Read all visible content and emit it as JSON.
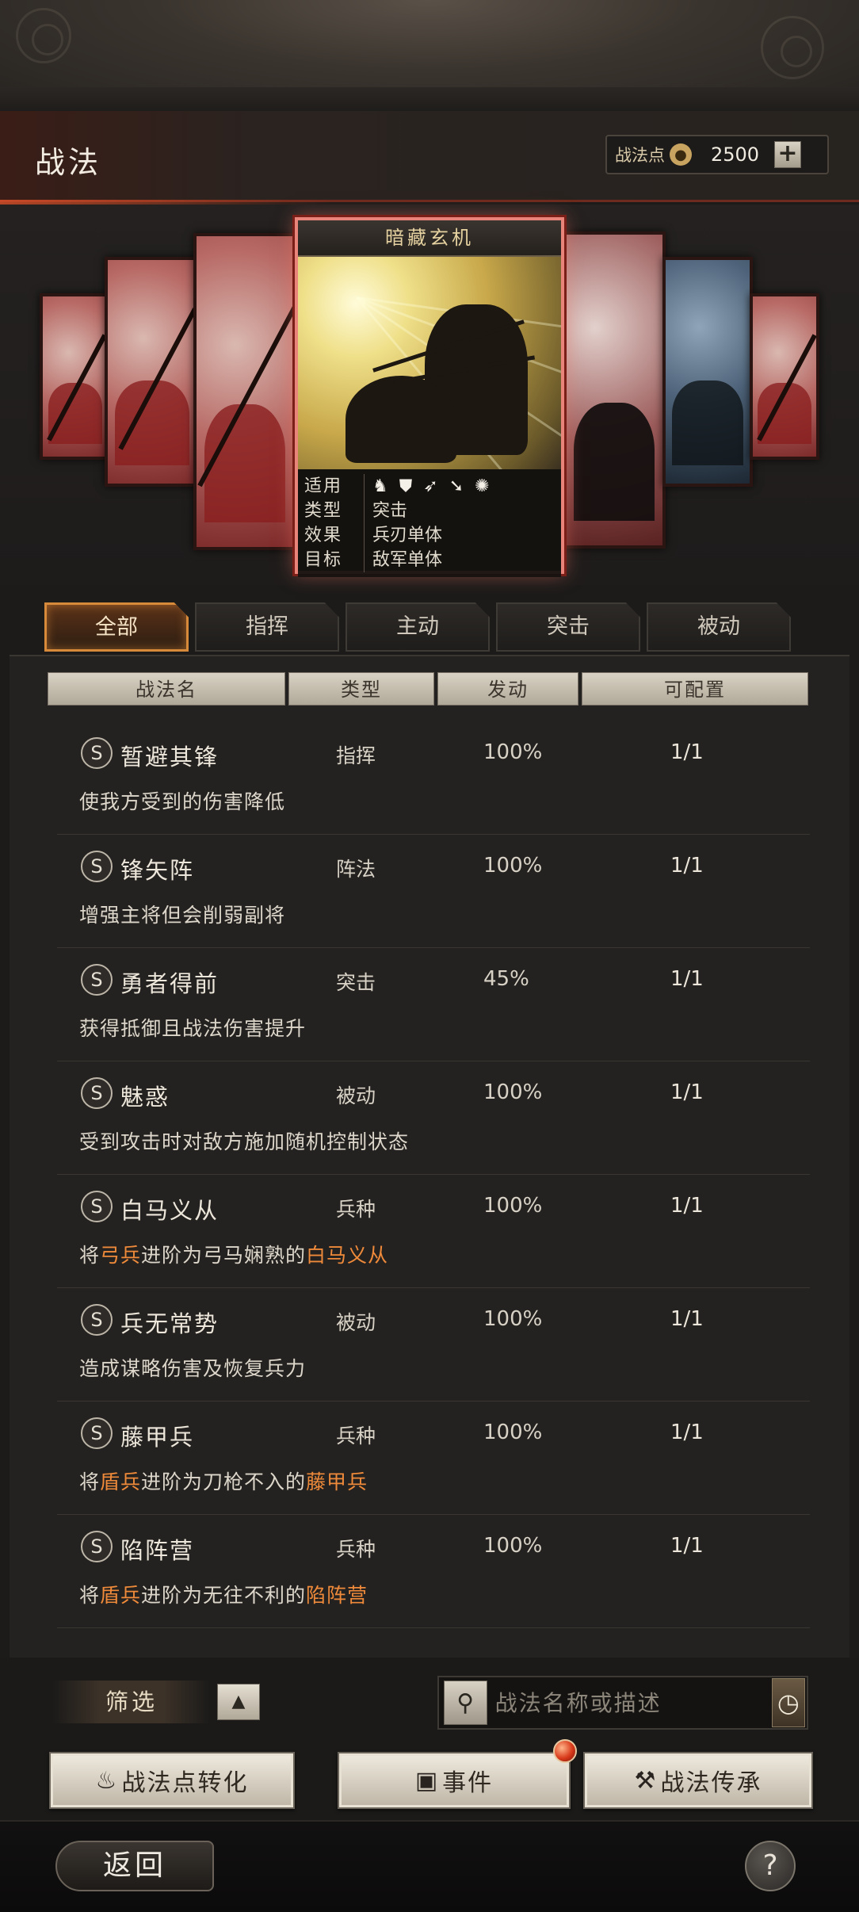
{
  "header": {
    "title": "战法",
    "points_label": "战法点",
    "points_value": "2500",
    "plus_label": "+"
  },
  "featured_card": {
    "title": "暗藏玄机",
    "info": [
      {
        "key": "适用",
        "value": ""
      },
      {
        "key": "类型",
        "value": "突击"
      },
      {
        "key": "效果",
        "value": "兵刃单体"
      },
      {
        "key": "目标",
        "value": "敌军单体"
      }
    ],
    "unit_icons": [
      "cavalry-icon",
      "shield-icon",
      "bow-icon",
      "spear-icon",
      "chariot-icon"
    ]
  },
  "tabs": [
    {
      "label": "全部",
      "active": true
    },
    {
      "label": "指挥",
      "active": false
    },
    {
      "label": "主动",
      "active": false
    },
    {
      "label": "突击",
      "active": false
    },
    {
      "label": "被动",
      "active": false
    }
  ],
  "columns": {
    "name": "战法名",
    "type": "类型",
    "rate": "发动",
    "config": "可配置"
  },
  "skills": [
    {
      "grade": "S",
      "name": "暂避其锋",
      "type": "指挥",
      "rate": "100%",
      "count": "1/1",
      "desc": [
        {
          "t": "使我方受到的伤害降低",
          "hl": false
        }
      ]
    },
    {
      "grade": "S",
      "name": "锋矢阵",
      "type": "阵法",
      "rate": "100%",
      "count": "1/1",
      "desc": [
        {
          "t": "增强主将但会削弱副将",
          "hl": false
        }
      ]
    },
    {
      "grade": "S",
      "name": "勇者得前",
      "type": "突击",
      "rate": "45%",
      "count": "1/1",
      "desc": [
        {
          "t": "获得抵御且战法伤害提升",
          "hl": false
        }
      ]
    },
    {
      "grade": "S",
      "name": "魅惑",
      "type": "被动",
      "rate": "100%",
      "count": "1/1",
      "desc": [
        {
          "t": "受到攻击时对敌方施加随机控制状态",
          "hl": false
        }
      ]
    },
    {
      "grade": "S",
      "name": "白马义从",
      "type": "兵种",
      "rate": "100%",
      "count": "1/1",
      "desc": [
        {
          "t": "将",
          "hl": false
        },
        {
          "t": "弓兵",
          "hl": true
        },
        {
          "t": "进阶为弓马娴熟的",
          "hl": false
        },
        {
          "t": "白马义从",
          "hl": true
        }
      ]
    },
    {
      "grade": "S",
      "name": "兵无常势",
      "type": "被动",
      "rate": "100%",
      "count": "1/1",
      "desc": [
        {
          "t": "造成谋略伤害及恢复兵力",
          "hl": false
        }
      ]
    },
    {
      "grade": "S",
      "name": "藤甲兵",
      "type": "兵种",
      "rate": "100%",
      "count": "1/1",
      "desc": [
        {
          "t": "将",
          "hl": false
        },
        {
          "t": "盾兵",
          "hl": true
        },
        {
          "t": "进阶为刀枪不入的",
          "hl": false
        },
        {
          "t": "藤甲兵",
          "hl": true
        }
      ]
    },
    {
      "grade": "S",
      "name": "陷阵营",
      "type": "兵种",
      "rate": "100%",
      "count": "1/1",
      "desc": [
        {
          "t": "将",
          "hl": false
        },
        {
          "t": "盾兵",
          "hl": true
        },
        {
          "t": "进阶为无往不利的",
          "hl": false
        },
        {
          "t": "陷阵营",
          "hl": true
        }
      ]
    }
  ],
  "bottom": {
    "filter_label": "筛选",
    "filter_toggle": "▲",
    "search_placeholder": "战法名称或描述",
    "buttons": {
      "convert": "战法点转化",
      "event": "事件",
      "inherit": "战法传承"
    }
  },
  "footer": {
    "back_label": "返回",
    "help_label": "?"
  },
  "colors": {
    "highlight": "#ee8a3a",
    "active_tab_border": "#d68a3a",
    "card_border": "#e8847a"
  }
}
